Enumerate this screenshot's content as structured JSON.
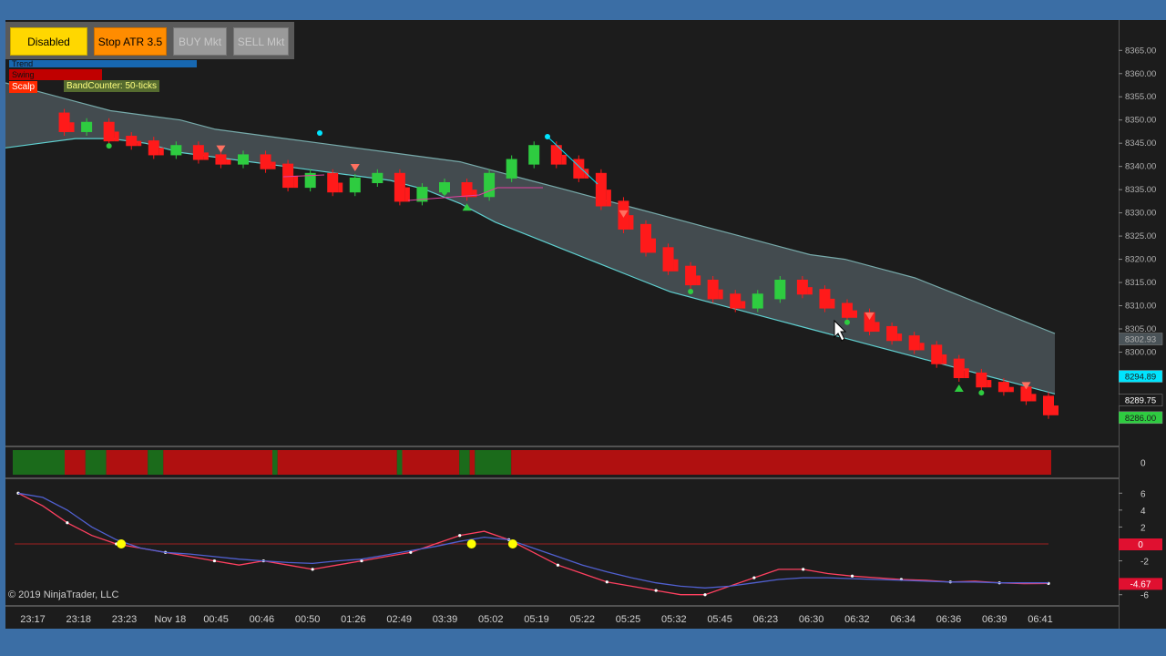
{
  "toolbar": {
    "disabled_label": "Disabled",
    "stop_label": "Stop ATR  3.5",
    "buy_label": "BUY Mkt",
    "sell_label": "SELL Mkt"
  },
  "legend": {
    "trend": "Trend",
    "swing": "Swing",
    "scalp": "Scalp",
    "band_counter": "BandCounter: 50-ticks"
  },
  "copyright": "© 2019 NinjaTrader, LLC",
  "colors": {
    "background": "#1c1c1c",
    "up_bar": "#2ecc40",
    "down_bar": "#ff1a1a",
    "band_fill": "#4a5358",
    "band_line": "#5fd0d0",
    "strip_red": "#b01010",
    "strip_green": "#1b6b1b"
  },
  "chart_data": [
    {
      "type": "line",
      "name": "price-panel",
      "y_ticks": [
        "8365.00",
        "8360.00",
        "8355.00",
        "8350.00",
        "8345.00",
        "8340.00",
        "8335.00",
        "8330.00",
        "8325.00",
        "8320.00",
        "8315.00",
        "8310.00",
        "8305.00",
        "8300.00"
      ],
      "ylim": [
        8284,
        8368
      ],
      "x_ticks": [
        "23:17",
        "23:18",
        "23:23",
        "Nov 18",
        "00:45",
        "00:46",
        "00:50",
        "01:26",
        "02:49",
        "03:39",
        "05:02",
        "05:19",
        "05:22",
        "05:25",
        "05:32",
        "05:45",
        "06:23",
        "06:30",
        "06:32",
        "06:34",
        "06:36",
        "06:39",
        "06:41"
      ],
      "close": [
        8351,
        8348,
        8349,
        8346,
        8345,
        8343,
        8344,
        8342,
        8341,
        8342,
        8340,
        8336,
        8338,
        8335,
        8337,
        8338,
        8333,
        8335,
        8336,
        8334,
        8338,
        8341,
        8344,
        8341,
        8338,
        8332,
        8327,
        8322,
        8318,
        8315,
        8312,
        8310,
        8312,
        8315,
        8313,
        8310,
        8308,
        8305,
        8303,
        8301,
        8298,
        8295,
        8293,
        8292,
        8290,
        8287
      ],
      "band_upper": [
        8358,
        8356,
        8354,
        8352,
        8351,
        8350,
        8348,
        8347,
        8346,
        8345,
        8344,
        8343,
        8342,
        8341,
        8339,
        8337,
        8335,
        8333,
        8331,
        8329,
        8327,
        8325,
        8323,
        8321,
        8320,
        8318,
        8316,
        8313,
        8310,
        8307,
        8304
      ],
      "band_lower": [
        8344,
        8345,
        8346,
        8346,
        8345,
        8343,
        8342,
        8341,
        8340,
        8339,
        8338,
        8337,
        8335,
        8332,
        8328,
        8325,
        8322,
        8319,
        8316,
        8313,
        8311,
        8309,
        8307,
        8305,
        8303,
        8301,
        8299,
        8297,
        8295,
        8293,
        8291
      ],
      "price_labels": [
        {
          "value": "8302.93",
          "color": "#4a5358",
          "text_color": "#b0b0b0"
        },
        {
          "value": "8294.89",
          "color": "#00e5ff",
          "text_color": "#1c1c1c"
        },
        {
          "value": "8289.75",
          "color": "#1c1c1c",
          "text_color": "#ffffff"
        },
        {
          "value": "8286.00",
          "color": "#2ecc40",
          "text_color": "#1c1c1c"
        }
      ]
    },
    {
      "type": "heatmap",
      "name": "trend-strip",
      "y_ticks": [
        "0"
      ],
      "segments": [
        {
          "state": "green",
          "span": [
            0,
            0.05
          ]
        },
        {
          "state": "red",
          "span": [
            0.05,
            0.07
          ]
        },
        {
          "state": "green",
          "span": [
            0.07,
            0.09
          ]
        },
        {
          "state": "red",
          "span": [
            0.09,
            0.13
          ]
        },
        {
          "state": "green",
          "span": [
            0.13,
            0.145
          ]
        },
        {
          "state": "red",
          "span": [
            0.145,
            0.25
          ]
        },
        {
          "state": "green",
          "span": [
            0.25,
            0.255
          ]
        },
        {
          "state": "red",
          "span": [
            0.255,
            0.37
          ]
        },
        {
          "state": "green",
          "span": [
            0.37,
            0.375
          ]
        },
        {
          "state": "red",
          "span": [
            0.375,
            0.43
          ]
        },
        {
          "state": "green",
          "span": [
            0.43,
            0.44
          ]
        },
        {
          "state": "red",
          "span": [
            0.44,
            0.445
          ]
        },
        {
          "state": "green",
          "span": [
            0.445,
            0.48
          ]
        },
        {
          "state": "red",
          "span": [
            0.48,
            1.0
          ]
        }
      ]
    },
    {
      "type": "line",
      "name": "oscillator",
      "y_ticks": [
        "6",
        "4",
        "2",
        "0",
        "-2",
        "-6"
      ],
      "ylim": [
        -7,
        7
      ],
      "zero_label": "0",
      "value_labels": [
        "-4.67"
      ],
      "series": [
        {
          "values": [
            6.0,
            4.5,
            2.5,
            1.0,
            0.0,
            -0.5,
            -1.0,
            -1.5,
            -2.0,
            -2.5,
            -2.0,
            -2.5,
            -3.0,
            -2.5,
            -2.0,
            -1.5,
            -1.0,
            0.0,
            1.0,
            1.5,
            0.5,
            -1.0,
            -2.5,
            -3.5,
            -4.5,
            -5.0,
            -5.5,
            -6.0,
            -6.0,
            -5.0,
            -4.0,
            -3.0,
            -3.0,
            -3.5,
            -3.8,
            -4.0,
            -4.2,
            -4.3,
            -4.5,
            -4.4,
            -4.6,
            -4.7,
            -4.67
          ]
        },
        {
          "values": [
            6.0,
            5.5,
            4.0,
            2.0,
            0.5,
            -0.5,
            -1.0,
            -1.2,
            -1.5,
            -1.8,
            -2.0,
            -2.2,
            -2.3,
            -2.0,
            -1.8,
            -1.3,
            -0.8,
            -0.3,
            0.3,
            0.8,
            0.5,
            -0.5,
            -1.5,
            -2.5,
            -3.3,
            -4.0,
            -4.6,
            -5.0,
            -5.2,
            -5.0,
            -4.6,
            -4.2,
            -4.0,
            -4.0,
            -4.1,
            -4.2,
            -4.3,
            -4.4,
            -4.5,
            -4.5,
            -4.6,
            -4.6,
            -4.6
          ]
        }
      ],
      "markers_at_zero": [
        0.1,
        0.44,
        0.48
      ]
    }
  ]
}
